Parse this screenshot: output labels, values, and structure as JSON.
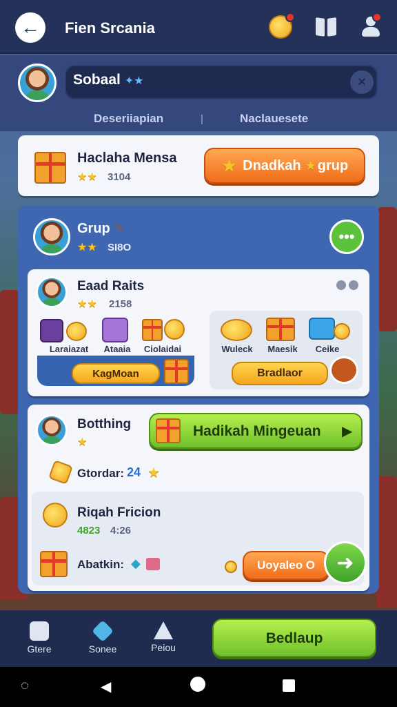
{
  "header": {
    "title": "Fien Srcania",
    "icons": [
      "coin-notification-icon",
      "book-icon",
      "profile-alert-icon"
    ]
  },
  "search": {
    "value": "Sobaal",
    "decor": "✦★"
  },
  "tabs": [
    {
      "label": "Deseriiapian"
    },
    {
      "label": "Naclauesete"
    }
  ],
  "top_card": {
    "title": "Haclaha Mensa",
    "stars": "★★",
    "value": "3104",
    "button_label": "Dnadkah",
    "button_suffix": "grup"
  },
  "group": {
    "name": "Grup",
    "stars": "★★",
    "value": "SI8O"
  },
  "card_a": {
    "name": "Eaad Raits",
    "stars": "★★",
    "value": "2158",
    "left_items": [
      {
        "label": "Laraiazat"
      },
      {
        "label": "Ataaia"
      },
      {
        "label": "Ciolaidai"
      }
    ],
    "left_button": "KagMoan",
    "right_items": [
      {
        "label": "Wuleck"
      },
      {
        "label": "Maesik"
      },
      {
        "label": "Ceike"
      }
    ],
    "right_button": "Bradlaor"
  },
  "card_b": {
    "name": "Botthing",
    "stars": "★",
    "green_button": "Hadikah Mingeuan",
    "reward_label": "Gtordar:",
    "reward_value": "24",
    "friend_title": "Riqah Fricion",
    "friend_value_1": "4823",
    "friend_value_2": "4:26",
    "action_label": "Abatkin:",
    "action_button": "Uoyaleo O"
  },
  "bottom_nav": {
    "items": [
      {
        "label": "Gtere"
      },
      {
        "label": "Sonee"
      },
      {
        "label": "Peiou"
      }
    ],
    "main_button": "Bedlaup"
  },
  "colors": {
    "topbar": "#243259",
    "accent_orange": "#f06c1b",
    "accent_green": "#6fc12b",
    "panel_blue": "#3f67b1"
  }
}
